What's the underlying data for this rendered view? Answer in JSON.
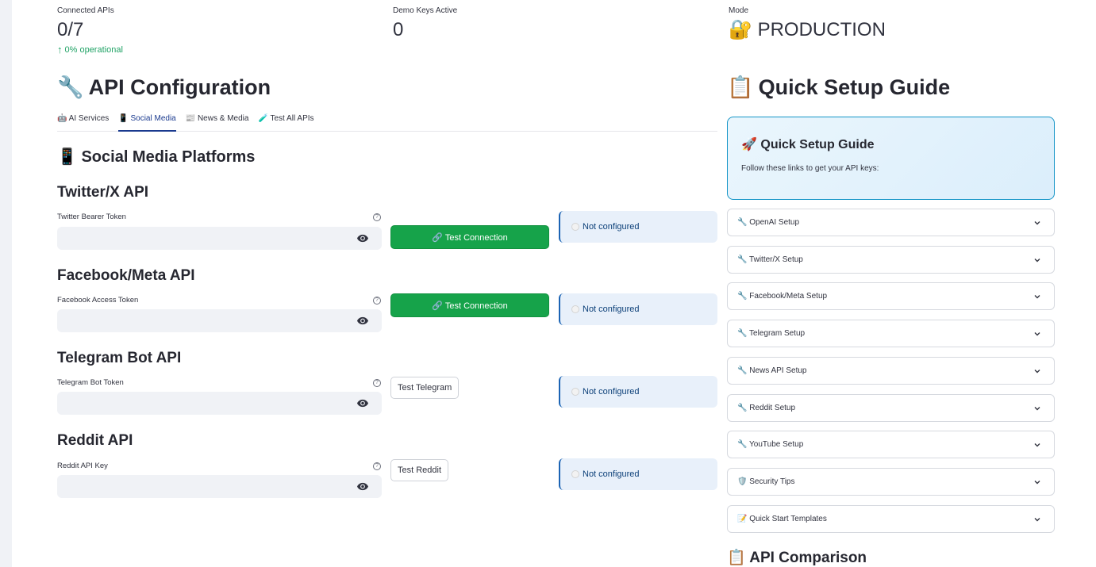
{
  "metrics": [
    {
      "label": "Connected APIs",
      "value": "0/7",
      "delta": "0% operational"
    },
    {
      "label": "Demo Keys Active",
      "value": "0"
    },
    {
      "label": "Mode",
      "value": "PRODUCTION",
      "icon": "🔐"
    }
  ],
  "config": {
    "title": "API Configuration",
    "title_icon": "🔧",
    "tabs": [
      {
        "label": "🤖 AI Services"
      },
      {
        "label": "📱 Social Media"
      },
      {
        "label": "📰 News & Media"
      },
      {
        "label": "🧪 Test All APIs"
      }
    ],
    "active_tab": 1,
    "section_title": "📱 Social Media Platforms",
    "apis": [
      {
        "heading": "Twitter/X API",
        "field_label": "Twitter Bearer Token",
        "button": "🔗 Test Connection",
        "status": "Not configured"
      },
      {
        "heading": "Facebook/Meta API",
        "field_label": "Facebook Access Token",
        "button": "🔗 Test Connection",
        "status": "Not configured"
      },
      {
        "heading": "Telegram Bot API",
        "field_label": "Telegram Bot Token",
        "button": "Test Telegram",
        "status": "Not configured"
      },
      {
        "heading": "Reddit API",
        "field_label": "Reddit API Key",
        "button": "Test Reddit",
        "status": "Not configured"
      }
    ]
  },
  "guide": {
    "title": "Quick Setup Guide",
    "title_icon": "📋",
    "box_title": "🚀 Quick Setup Guide",
    "box_text": "Follow these links to get your API keys:",
    "expanders": [
      "🔧 OpenAI Setup",
      "🔧 Twitter/X Setup",
      "🔧 Facebook/Meta Setup",
      "🔧 Telegram Setup",
      "🔧 News API Setup",
      "🔧 Reddit Setup",
      "🔧 YouTube Setup",
      "🛡️ Security Tips",
      "📝 Quick Start Templates"
    ],
    "comparison_title": "📋 API Comparison"
  },
  "colors": {
    "primary_button": "#16a34a",
    "status_bg": "#e8f0fa",
    "status_border": "#1c64b4",
    "tab_active": "#1a3a8f",
    "delta": "#21a366"
  }
}
